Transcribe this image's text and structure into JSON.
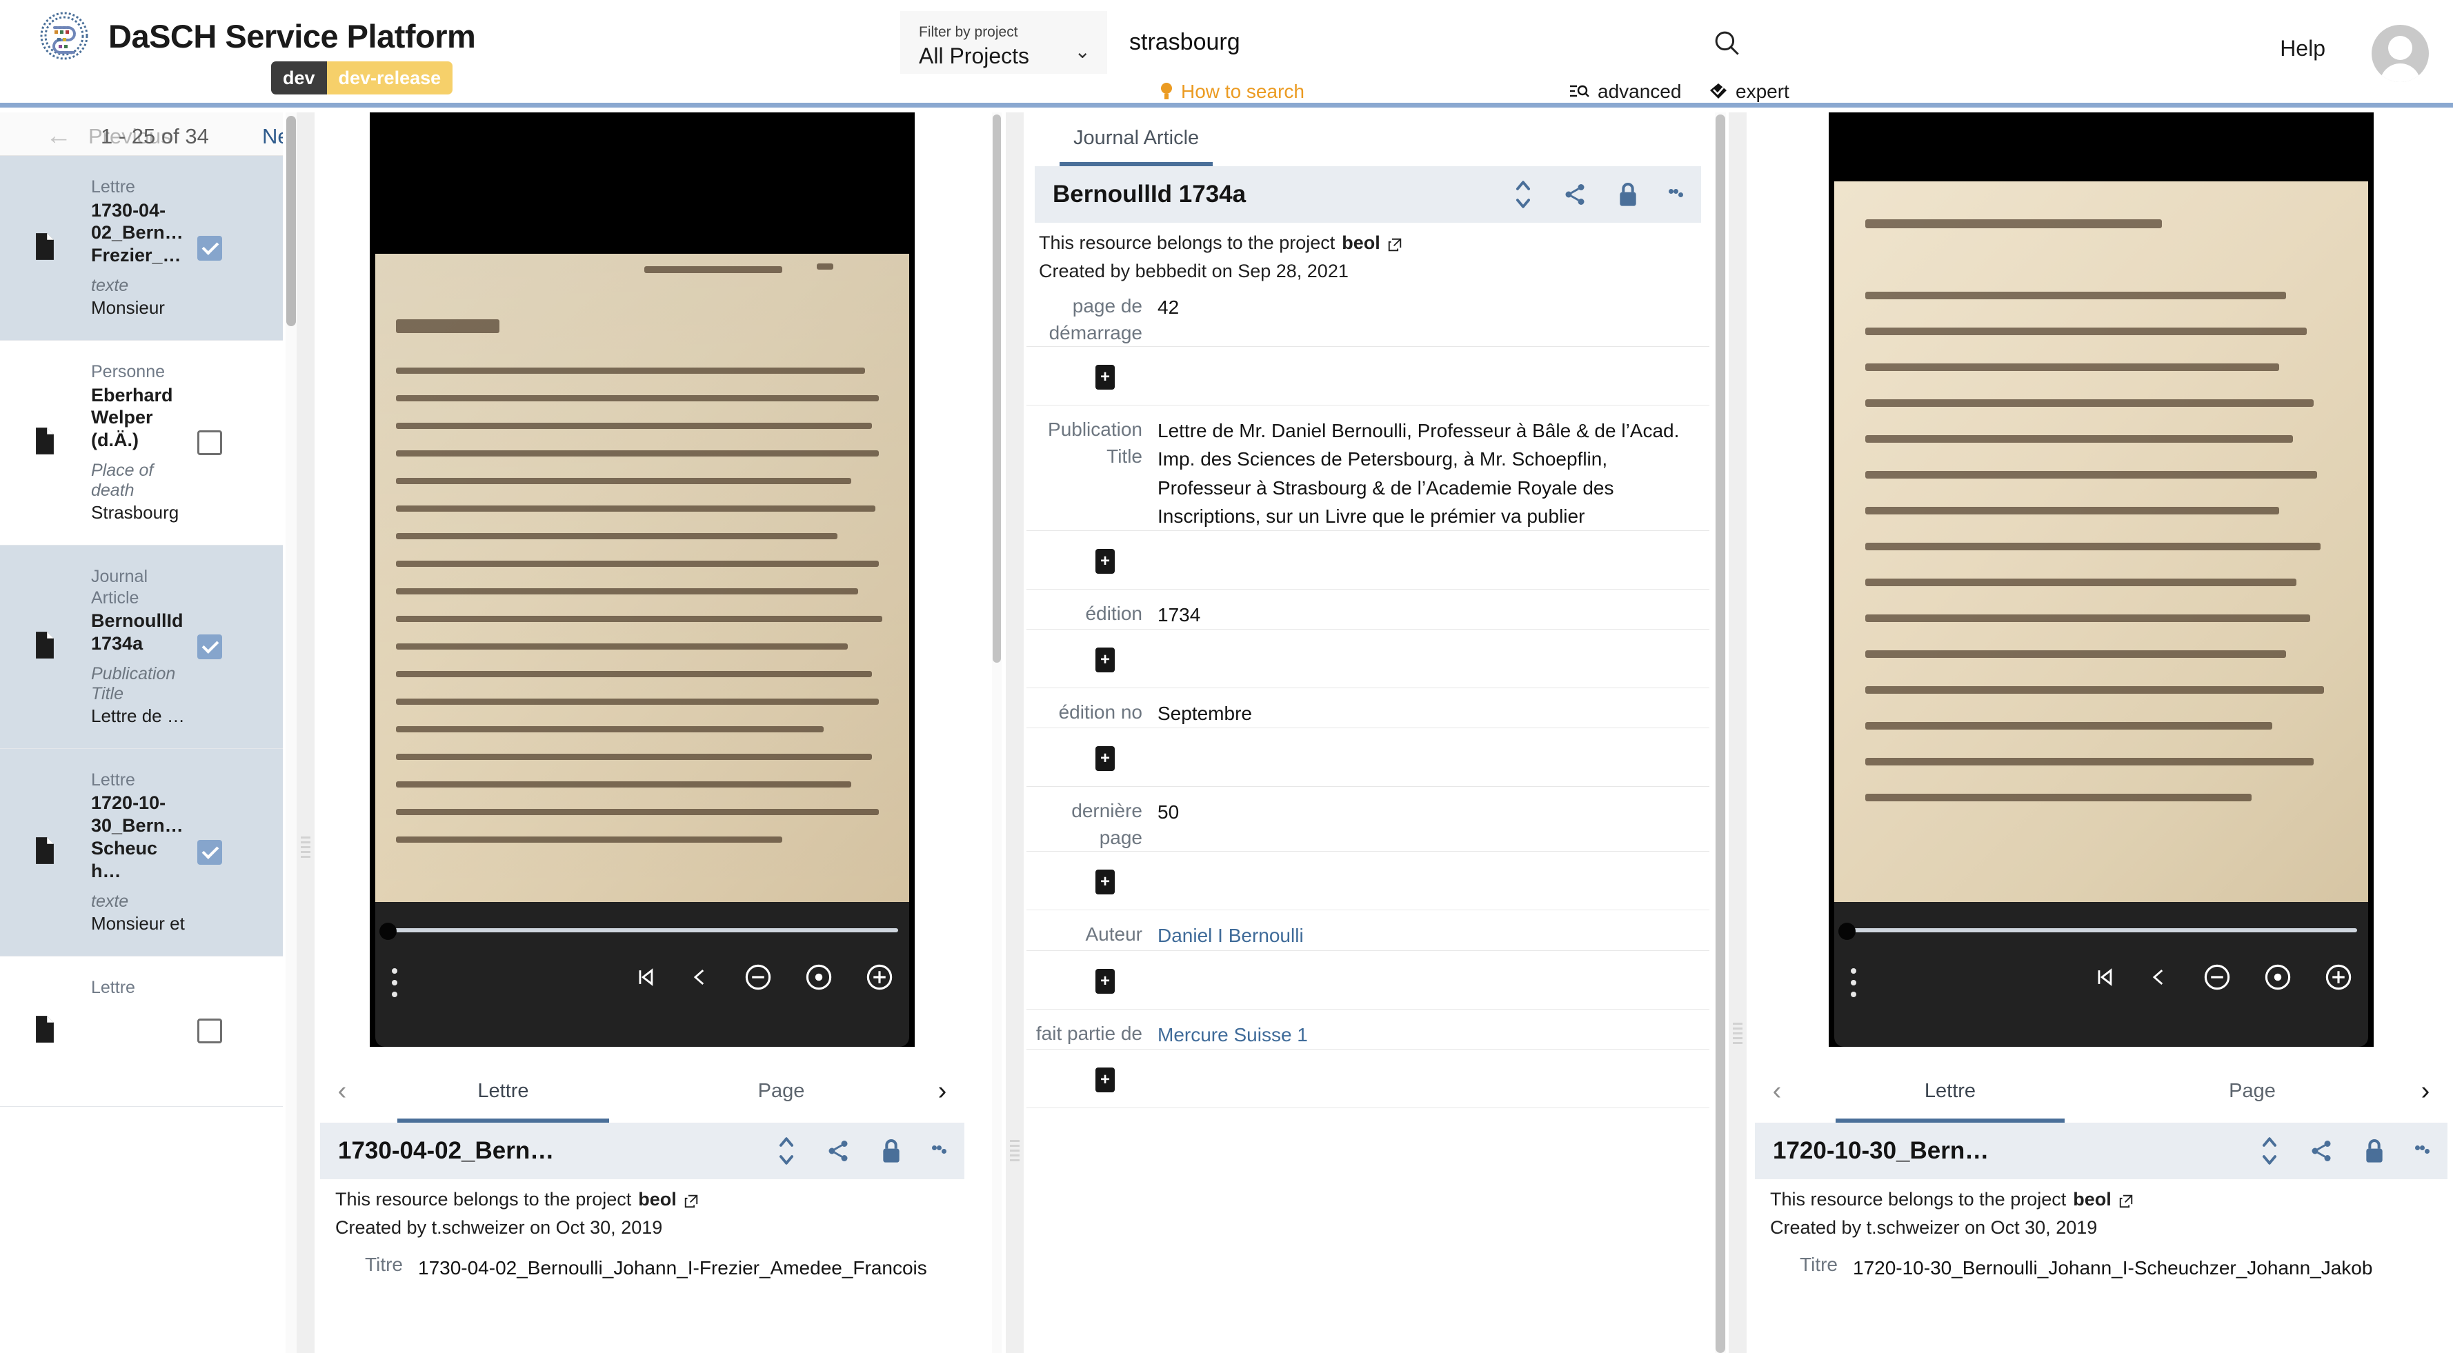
{
  "app": {
    "title": "DaSCH Service Platform",
    "badge_left": "dev",
    "badge_right": "dev-release",
    "help_label": "Help",
    "accent_blue": "#8aa8d0",
    "badge_yellow": "#f6d06a",
    "link_blue": "#3f6b99"
  },
  "search": {
    "filter_label": "Filter by project",
    "filter_value": "All Projects",
    "query": "strasbourg",
    "placeholder": "Search",
    "how_to_search": "How to search",
    "advanced": "advanced",
    "expert": "expert"
  },
  "sidebar": {
    "back_icon": "arrow-left-icon",
    "prev_label": "Previous",
    "count_label": "1 - 25 of 34",
    "next_label": "Next",
    "items": [
      {
        "type": "Lettre",
        "label": "1730-04-02_Bern… Frezier_…",
        "label_lines": [
          "1730-04-",
          "02_Bern…",
          "Frezier_…"
        ],
        "prop": "texte",
        "value": "Monsieur",
        "selected": true,
        "checked": true
      },
      {
        "type": "Personne",
        "label": "Eberhard Welper (d.Ä.)",
        "label_lines": [
          "Eberhard",
          "Welper",
          "(d.Ä.)"
        ],
        "prop": "Place of death",
        "value": "Strasbourg",
        "selected": false,
        "checked": false
      },
      {
        "type": "Journal Article",
        "label": "BernoullId 1734a",
        "label_lines": [
          "BernoullId",
          "1734a"
        ],
        "prop": "Publication Title",
        "value": "Lettre de …",
        "selected": true,
        "checked": true
      },
      {
        "type": "Lettre",
        "label": "1720-10-30_Bern… Scheuch…",
        "label_lines": [
          "1720-10-",
          "30_Bern…",
          "Scheuch…"
        ],
        "prop": "texte",
        "value": "Monsieur et",
        "selected": true,
        "checked": true
      },
      {
        "type": "Lettre",
        "label": "",
        "label_lines": [],
        "prop": "",
        "value": "",
        "selected": false,
        "checked": false
      }
    ]
  },
  "viewer_toolbar": {
    "menu_icon": "more-vertical-icon",
    "first_page_icon": "skip-to-start-icon",
    "prev_page_icon": "chevron-left-icon",
    "zoom_out_icon": "zoom-out-icon",
    "reset_icon": "reset-view-icon",
    "zoom_in_icon": "zoom-in-icon"
  },
  "panels": {
    "left": {
      "tabs": {
        "prev_icon": "chevron-left-icon",
        "next_icon": "chevron-right-icon",
        "items": [
          {
            "label": "Lettre",
            "active": true
          },
          {
            "label": "Page",
            "active": false
          }
        ]
      },
      "resource": {
        "title": "1730-04-02_Bern…",
        "project_text_prefix": "This resource belongs to the project",
        "project_name": "beol",
        "created_by": "Created by t.schweizer on Oct 30, 2019",
        "prop_key": "Titre",
        "prop_value": "1730-04-02_Bernoulli_Johann_I-Frezier_Amedee_Francois"
      }
    },
    "middle": {
      "tab_label": "Journal Article",
      "resource": {
        "title": "BernoullId 1734a",
        "project_text_prefix": "This resource belongs to the project",
        "project_name": "beol",
        "created_by": "Created by bebbedit on Sep 28, 2021"
      },
      "properties": [
        {
          "key": "page de démarrage",
          "value": "42",
          "is_link": false
        },
        {
          "key": "Publication Title",
          "value": "Lettre de Mr. Daniel Bernoulli, Professeur à Bâle & de l’Acad. Imp. des Sciences de Petersbourg, à Mr. Schoepflin, Professeur à Strasbourg & de l’Academie Royale des Inscriptions, sur un Livre que le prémier va publier",
          "is_link": false
        },
        {
          "key": "édition",
          "value": "1734",
          "is_link": false
        },
        {
          "key": "édition no",
          "value": "Septembre",
          "is_link": false
        },
        {
          "key": "dernière page",
          "value": "50",
          "is_link": false
        },
        {
          "key": "Auteur",
          "value": "Daniel I Bernoulli",
          "is_link": true
        },
        {
          "key": "fait partie de",
          "value": "Mercure Suisse 1",
          "is_link": true
        }
      ],
      "add_button_label": "+"
    },
    "right": {
      "tabs": {
        "prev_icon": "chevron-left-icon",
        "next_icon": "chevron-right-icon",
        "items": [
          {
            "label": "Lettre",
            "active": true
          },
          {
            "label": "Page",
            "active": false
          }
        ]
      },
      "resource": {
        "title": "1720-10-30_Bern…",
        "project_text_prefix": "This resource belongs to the project",
        "project_name": "beol",
        "created_by": "Created by t.schweizer on Oct 30, 2019",
        "prop_key": "Titre",
        "prop_value": "1720-10-30_Bernoulli_Johann_I-Scheuchzer_Johann_Jakob"
      }
    }
  },
  "icons": {
    "sort": "sort-vertical-icon",
    "share": "share-icon",
    "lock": "lock-icon",
    "more": "more-vertical-icon",
    "external": "external-link-icon",
    "file": "file-icon"
  }
}
